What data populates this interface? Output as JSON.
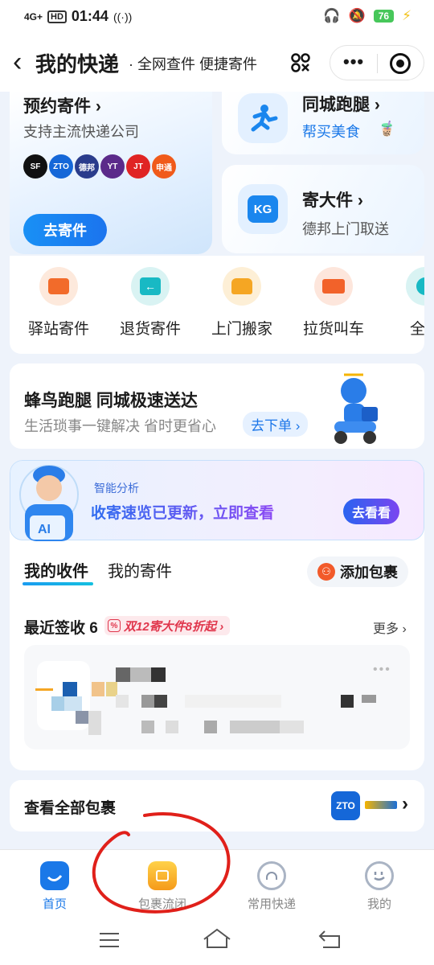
{
  "status_bar": {
    "signal": "4G+",
    "hd": "HD",
    "time": "01:44",
    "battery": "76"
  },
  "header": {
    "title": "我的快递",
    "subtitle": "· 全网查件 便捷寄件"
  },
  "cards": {
    "appointment": {
      "title": "预约寄件 ›",
      "sub": "支持主流快递公司",
      "button": "去寄件",
      "logos": [
        "SF",
        "ZTO",
        "德邦",
        "YT",
        "JT",
        "申通"
      ]
    },
    "errand": {
      "title": "同城跑腿 ›",
      "sub": "帮买美食"
    },
    "big_item": {
      "title": "寄大件 ›",
      "sub": "德邦上门取送",
      "icon_text": "KG"
    }
  },
  "services": [
    {
      "label": "驿站寄件"
    },
    {
      "label": "退货寄件"
    },
    {
      "label": "上门搬家"
    },
    {
      "label": "拉货叫车"
    },
    {
      "label": "全球"
    }
  ],
  "promo": {
    "title": "蜂鸟跑腿 同城极速送达",
    "sub": "生活琐事一键解决 省时更省心",
    "button": "去下单 ›"
  },
  "analysis": {
    "tag": "智能分析",
    "text": "收寄速览已更新，立即查看",
    "button": "去看看"
  },
  "tabs": {
    "received": "我的收件",
    "sent": "我的寄件",
    "add_package": "添加包裹"
  },
  "recent": {
    "title": "最近签收 6",
    "promo": "双12寄大件8折起 ›",
    "more": "更多 ›"
  },
  "view_all": {
    "label": "查看全部包裹",
    "logo": "ZTO"
  },
  "bottom_nav": [
    {
      "label": "首页"
    },
    {
      "label": "包裹流闭"
    },
    {
      "label": "常用快递"
    },
    {
      "label": "我的"
    }
  ],
  "colors": {
    "accent": "#1a78e8",
    "annotation": "#e0201a"
  }
}
